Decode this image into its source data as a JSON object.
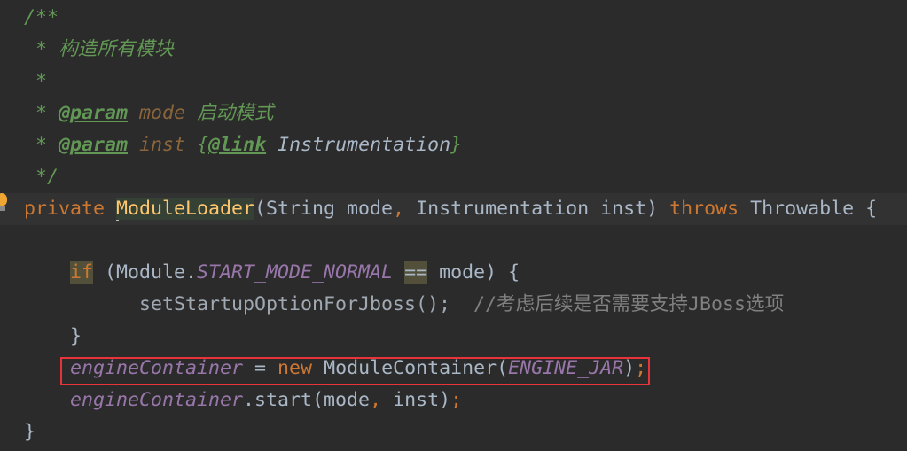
{
  "editor": {
    "current_line": 6,
    "highlight_box_line": 11,
    "colors": {
      "background": "#2b2b2b",
      "current_line": "#323232",
      "keyword": "#cc7832",
      "comment": "#629755",
      "highlight_box": "#e8333a"
    },
    "lines": [
      {
        "tokens": [
          {
            "t": "/**",
            "c": "cm"
          }
        ]
      },
      {
        "tokens": [
          {
            "t": " * 构造所有模块",
            "c": "cm"
          }
        ]
      },
      {
        "tokens": [
          {
            "t": " *",
            "c": "cm"
          }
        ]
      },
      {
        "tokens": [
          {
            "t": " * ",
            "c": "cm"
          },
          {
            "t": "@param",
            "c": "tag"
          },
          {
            "t": " ",
            "c": "cm"
          },
          {
            "t": "mode",
            "c": "pn"
          },
          {
            "t": " 启动模式",
            "c": "cm"
          }
        ]
      },
      {
        "tokens": [
          {
            "t": " * ",
            "c": "cm"
          },
          {
            "t": "@param",
            "c": "tag"
          },
          {
            "t": " ",
            "c": "cm"
          },
          {
            "t": "inst",
            "c": "pn"
          },
          {
            "t": " {",
            "c": "cm"
          },
          {
            "t": "@link",
            "c": "tag"
          },
          {
            "t": " ",
            "c": "cm"
          },
          {
            "t": "Instrumentation",
            "c": "lk"
          },
          {
            "t": "}",
            "c": "cm"
          }
        ]
      },
      {
        "tokens": [
          {
            "t": " */",
            "c": "cm"
          }
        ]
      },
      {
        "tokens": [
          {
            "t": "private ",
            "c": "kw"
          },
          {
            "t": "",
            "c": "caret"
          },
          {
            "t": "ModuleLoader",
            "c": "fn"
          },
          {
            "t": "(String mode",
            "c": "pl"
          },
          {
            "t": ",",
            "c": "kw"
          },
          {
            "t": " Instrumentation inst) ",
            "c": "pl"
          },
          {
            "t": "throws",
            "c": "kw"
          },
          {
            "t": " Throwable {",
            "c": "pl"
          }
        ]
      },
      {
        "tokens": []
      },
      {
        "tokens": [
          {
            "t": "    ",
            "c": "pl"
          },
          {
            "t": "if",
            "c": "kw hl"
          },
          {
            "t": " (Module.",
            "c": "pl"
          },
          {
            "t": "START_MODE_NORMAL",
            "c": "st"
          },
          {
            "t": " ",
            "c": "pl"
          },
          {
            "t": "==",
            "c": "pl hl"
          },
          {
            "t": " mode) {",
            "c": "pl"
          }
        ]
      },
      {
        "tokens": [
          {
            "t": "          setStartupOptionForJboss();",
            "c": "dim"
          },
          {
            "t": "  //考虑后续是否需要支持JBoss选项",
            "c": "lc"
          }
        ]
      },
      {
        "tokens": [
          {
            "t": "    }",
            "c": "pl"
          }
        ]
      },
      {
        "tokens": [
          {
            "t": "    ",
            "c": "pl"
          },
          {
            "t": "engineContainer",
            "c": "st"
          },
          {
            "t": " = ",
            "c": "pl"
          },
          {
            "t": "new",
            "c": "kw"
          },
          {
            "t": " ModuleContainer(",
            "c": "pl"
          },
          {
            "t": "ENGINE_JAR",
            "c": "st"
          },
          {
            "t": ")",
            "c": "pl"
          },
          {
            "t": ";",
            "c": "kw"
          }
        ]
      },
      {
        "tokens": [
          {
            "t": "    ",
            "c": "pl"
          },
          {
            "t": "engineContainer",
            "c": "st"
          },
          {
            "t": ".start(mode",
            "c": "pl"
          },
          {
            "t": ",",
            "c": "kw"
          },
          {
            "t": " inst)",
            "c": "pl"
          },
          {
            "t": ";",
            "c": "kw"
          }
        ]
      },
      {
        "tokens": [
          {
            "t": "}",
            "c": "pl"
          }
        ]
      }
    ]
  }
}
